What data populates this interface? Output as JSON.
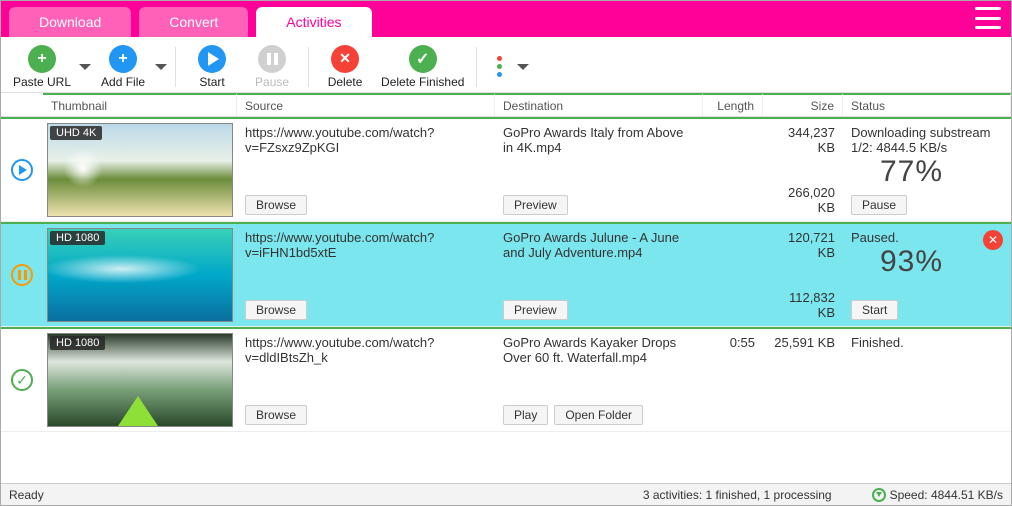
{
  "tabs": {
    "download": "Download",
    "convert": "Convert",
    "activities": "Activities"
  },
  "toolbar": {
    "paste_url": "Paste URL",
    "add_file": "Add File",
    "start": "Start",
    "pause": "Pause",
    "delete": "Delete",
    "delete_finished": "Delete Finished"
  },
  "columns": {
    "thumbnail": "Thumbnail",
    "source": "Source",
    "destination": "Destination",
    "length": "Length",
    "size": "Size",
    "status": "Status"
  },
  "rows": [
    {
      "state": "downloading",
      "badge": "UHD 4K",
      "source": "https://www.youtube.com/watch?v=FZsxz9ZpKGI",
      "dest": "GoPro Awards Italy from Above in 4K.mp4",
      "length": "",
      "size_line1": "344,237 KB",
      "size_line2": "266,020 KB",
      "status_text": "Downloading substream 1/2: 4844.5 KB/s",
      "percent": "77%",
      "btn_source": "Browse",
      "btn_dest": "Preview",
      "btn_status": "Pause"
    },
    {
      "state": "paused",
      "badge": "HD 1080",
      "source": "https://www.youtube.com/watch?v=iFHN1bd5xtE",
      "dest": "GoPro Awards Julune - A June and July Adventure.mp4",
      "length": "",
      "size_line1": "120,721 KB",
      "size_line2": "112,832 KB",
      "status_text": "Paused.",
      "percent": "93%",
      "btn_source": "Browse",
      "btn_dest": "Preview",
      "btn_status": "Start"
    },
    {
      "state": "finished",
      "badge": "HD 1080",
      "source": "https://www.youtube.com/watch?v=dldIBtsZh_k",
      "dest": "GoPro Awards Kayaker Drops Over 60 ft. Waterfall.mp4",
      "length": "0:55",
      "size_line1": "25,591 KB",
      "size_line2": "",
      "status_text": "Finished.",
      "percent": "",
      "btn_source": "Browse",
      "btn_dest1": "Play",
      "btn_dest2": "Open Folder",
      "btn_status": ""
    }
  ],
  "statusbar": {
    "ready": "Ready",
    "summary": "3 activities: 1 finished, 1 processing",
    "speed": "Speed: 4844.51 KB/s"
  }
}
